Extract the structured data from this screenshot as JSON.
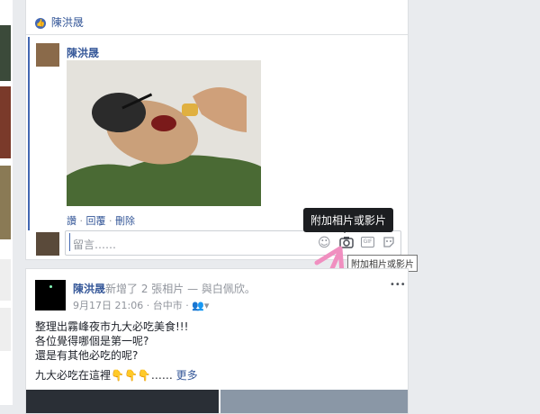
{
  "colors": {
    "accent": "#365899",
    "blue_bar": "#4267b2",
    "pink_arrow": "#f08fc0"
  },
  "liked_bar": {
    "name": "陳洪晟"
  },
  "comment": {
    "author": "陳洪晟",
    "actions": [
      "讚",
      "回覆",
      "刪除"
    ]
  },
  "composer": {
    "placeholder": "留言……",
    "icons": [
      "emoji-icon",
      "camera-icon",
      "gif-icon",
      "sticker-icon"
    ]
  },
  "tooltip": {
    "dark": "附加相片或影片",
    "light": "附加相片或影片"
  },
  "post": {
    "author": "陳洪晟",
    "action": "新增了 2 張相片 — 與白佩欣",
    "tail": "。",
    "date": "9月17日 21:06",
    "location": "台中市",
    "more": "•••",
    "lines": [
      "整理出霧峰夜市九大必吃美食!!!",
      "各位覺得哪個是第一呢?",
      "還是有其他必吃的呢?"
    ],
    "extra": "九大必吃在這裡👇👇👇……",
    "see_more": "更多"
  }
}
